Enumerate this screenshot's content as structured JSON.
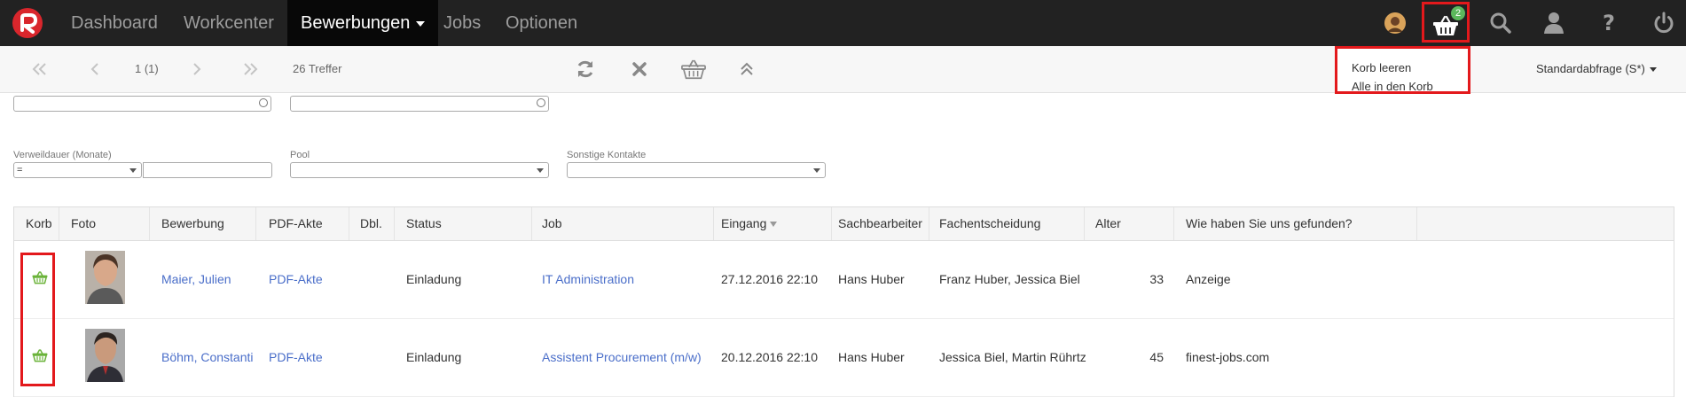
{
  "nav": {
    "items": [
      {
        "label": "Dashboard"
      },
      {
        "label": "Workcenter"
      },
      {
        "label": "Bewerbungen"
      },
      {
        "label": "Jobs"
      },
      {
        "label": "Optionen"
      }
    ],
    "basket_count": "2"
  },
  "toolbar": {
    "page_indicator": "1 (1)",
    "hits": "26 Treffer",
    "query_select": "Standardabfrage (S*)"
  },
  "basket_menu": {
    "items": [
      "Korb leeren",
      "Alle in den Korb"
    ]
  },
  "filters": {
    "verweildauer_label": "Verweildauer (Monate)",
    "verweildauer_operator": "=",
    "pool_label": "Pool",
    "contacts_label": "Sonstige Kontakte"
  },
  "table": {
    "headers": [
      "Korb",
      "Foto",
      "Bewerbung",
      "PDF-Akte",
      "Dbl.",
      "Status",
      "Job",
      "Eingang",
      "Sachbearbeiter",
      "Fachentscheidung",
      "Alter",
      "Wie haben Sie uns gefunden?"
    ],
    "rows": [
      {
        "name": "Maier, Julien",
        "pdf": "PDF-Akte",
        "status": "Einladung",
        "job": "IT Administration",
        "eingang": "27.12.2016 22:10",
        "sachbearbeiter": "Hans Huber",
        "fachentscheidung": "Franz Huber, Jessica Biel",
        "alter": "33",
        "quelle": "Anzeige"
      },
      {
        "name": "Böhm, Constantin",
        "pdf": "PDF-Akte",
        "status": "Einladung",
        "job": "Assistent Procurement (m/w)",
        "eingang": "20.12.2016 22:10",
        "sachbearbeiter": "Hans Huber",
        "fachentscheidung": "Jessica Biel, Martin Rührtz",
        "alter": "45",
        "quelle": "finest-jobs.com"
      }
    ]
  },
  "colors": {
    "navbar": "#222222",
    "highlight": "#e3191c",
    "link": "#4a6ec9",
    "basket_green": "#6bb33a",
    "badge_green": "#5cb85c"
  }
}
